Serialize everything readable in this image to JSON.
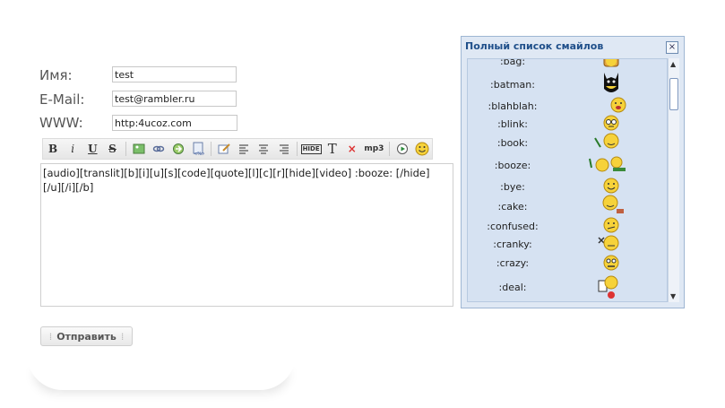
{
  "form": {
    "name_label": "Имя:",
    "email_label": "E-Mail:",
    "www_label": "WWW:",
    "name_value": "test",
    "email_value": "test@rambler.ru",
    "www_value": "http:4ucoz.com"
  },
  "toolbar": {
    "bold": "B",
    "italic": "i",
    "underline": "U",
    "strike": "S",
    "text_t": "T",
    "remove": "×",
    "mp3": "mp3",
    "hide": "HIDE"
  },
  "editor": {
    "content": "[audio][translit][b][i][u][s][code][quote][l][c][r][hide][video] :booze: [/hide]\n[/u][/i][/b]"
  },
  "submit": {
    "label": "Отправить"
  },
  "smiles_panel": {
    "title": "Полный список смайлов",
    "close": "×",
    "items": [
      {
        "code": ":bag:"
      },
      {
        "code": ":batman:"
      },
      {
        "code": ":blahblah:"
      },
      {
        "code": ":blink:"
      },
      {
        "code": ":book:"
      },
      {
        "code": ":booze:"
      },
      {
        "code": ":bye:"
      },
      {
        "code": ":cake:"
      },
      {
        "code": ":confused:"
      },
      {
        "code": ":cranky:"
      },
      {
        "code": ":crazy:"
      },
      {
        "code": ":deal:"
      }
    ]
  },
  "colors": {
    "panel_bg": "#dfe8f4",
    "panel_title": "#1f4f8a",
    "smile_yellow": "#f6d23a"
  }
}
